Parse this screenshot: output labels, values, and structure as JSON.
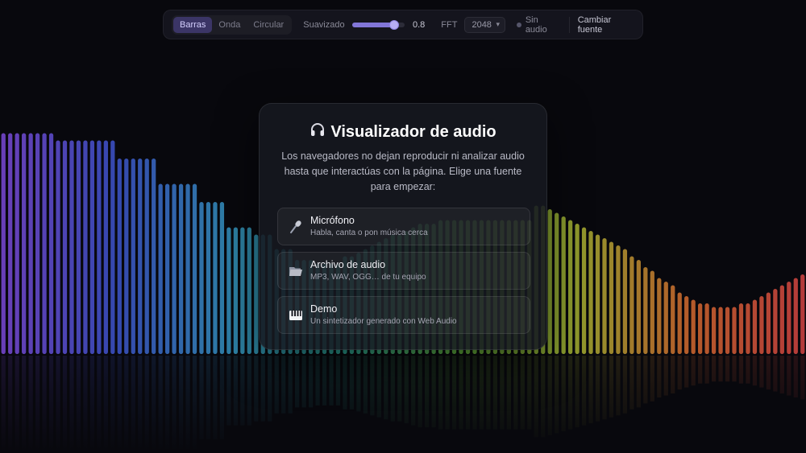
{
  "toolbar": {
    "modes": [
      {
        "label": "Barras",
        "active": true
      },
      {
        "label": "Onda",
        "active": false
      },
      {
        "label": "Circular",
        "active": false
      }
    ],
    "smoothing_label": "Suavizado",
    "smoothing_value": 0.8,
    "smoothing_value_text": "0.8",
    "fft_label": "FFT",
    "fft_value": "2048",
    "status_text": "Sin audio",
    "change_source_label": "Cambiar fuente"
  },
  "modal": {
    "title": "Visualizador de audio",
    "title_icon": "headphones-icon",
    "description": "Los navegadores no dejan reproducir ni analizar audio hasta que interactúas con la página. Elige una fuente para empezar:",
    "options": [
      {
        "icon": "microphone-icon",
        "title": "Micrófono",
        "subtitle": "Habla, canta o pon música cerca"
      },
      {
        "icon": "folder-icon",
        "title": "Archivo de audio",
        "subtitle": "MP3, WAV, OGG… de tu equipo"
      },
      {
        "icon": "piano-icon",
        "title": "Demo",
        "subtitle": "Un sintetizador generado con Web Audio"
      }
    ]
  },
  "visualizer": {
    "mode": "bars",
    "bar_levels": [
      0.61,
      0.61,
      0.61,
      0.61,
      0.61,
      0.61,
      0.61,
      0.61,
      0.59,
      0.59,
      0.59,
      0.59,
      0.59,
      0.59,
      0.59,
      0.59,
      0.59,
      0.54,
      0.54,
      0.54,
      0.54,
      0.54,
      0.54,
      0.47,
      0.47,
      0.47,
      0.47,
      0.47,
      0.47,
      0.42,
      0.42,
      0.42,
      0.42,
      0.35,
      0.35,
      0.35,
      0.35,
      0.33,
      0.33,
      0.33,
      0.29,
      0.29,
      0.29,
      0.26,
      0.26,
      0.26,
      0.25,
      0.25,
      0.25,
      0.25,
      0.27,
      0.27,
      0.28,
      0.29,
      0.3,
      0.31,
      0.32,
      0.33,
      0.33,
      0.34,
      0.35,
      0.36,
      0.36,
      0.36,
      0.37,
      0.37,
      0.37,
      0.37,
      0.37,
      0.37,
      0.37,
      0.37,
      0.37,
      0.37,
      0.37,
      0.37,
      0.37,
      0.37,
      0.41,
      0.41,
      0.4,
      0.39,
      0.38,
      0.37,
      0.36,
      0.35,
      0.34,
      0.33,
      0.32,
      0.31,
      0.3,
      0.29,
      0.27,
      0.26,
      0.24,
      0.23,
      0.21,
      0.2,
      0.19,
      0.17,
      0.16,
      0.15,
      0.14,
      0.14,
      0.13,
      0.13,
      0.13,
      0.13,
      0.14,
      0.14,
      0.15,
      0.16,
      0.17,
      0.18,
      0.19,
      0.2,
      0.21,
      0.22
    ],
    "colors": [
      "#6a3fb8",
      "#3548b0",
      "#2d7fa6",
      "#2a9a8a",
      "#5da83a",
      "#8f9a2c",
      "#b55a2a",
      "#b53a3a"
    ]
  }
}
